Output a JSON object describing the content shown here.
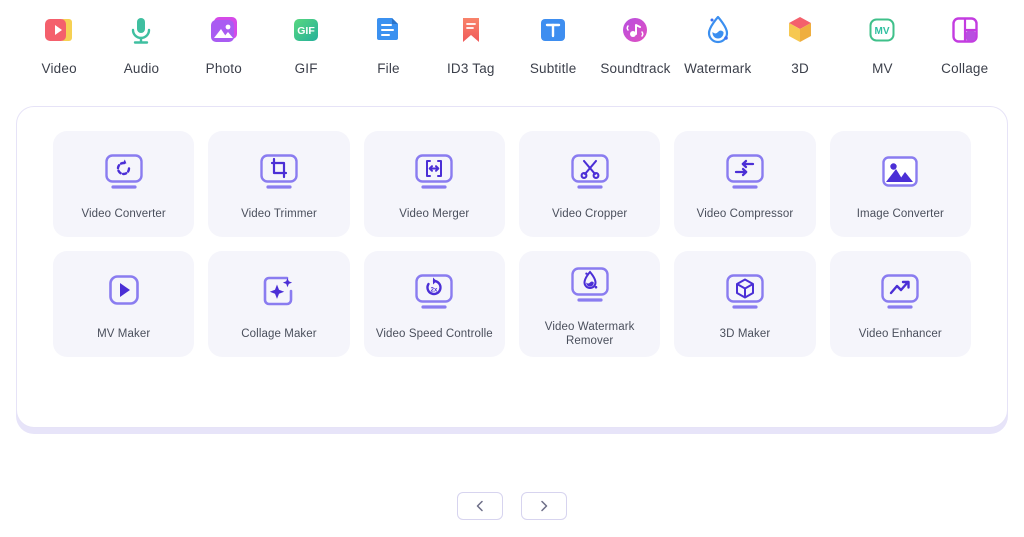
{
  "topnav": {
    "items": [
      {
        "label": "Video",
        "icon": "video-icon"
      },
      {
        "label": "Audio",
        "icon": "microphone-icon"
      },
      {
        "label": "Photo",
        "icon": "photo-icon"
      },
      {
        "label": "GIF",
        "icon": "gif-icon"
      },
      {
        "label": "File",
        "icon": "file-icon"
      },
      {
        "label": "ID3 Tag",
        "icon": "bookmark-icon"
      },
      {
        "label": "Subtitle",
        "icon": "subtitle-t-icon"
      },
      {
        "label": "Soundtrack",
        "icon": "soundtrack-disc-icon"
      },
      {
        "label": "Watermark",
        "icon": "watermark-drop-icon"
      },
      {
        "label": "3D",
        "icon": "cube-3d-icon"
      },
      {
        "label": "MV",
        "icon": "mv-icon"
      },
      {
        "label": "Collage",
        "icon": "collage-grid-icon"
      }
    ]
  },
  "tools": {
    "items": [
      {
        "label": "Video Converter",
        "icon": "monitor-rotate-icon"
      },
      {
        "label": "Video Trimmer",
        "icon": "monitor-crop-icon"
      },
      {
        "label": "Video Merger",
        "icon": "monitor-merge-icon"
      },
      {
        "label": "Video Cropper",
        "icon": "monitor-scissors-icon"
      },
      {
        "label": "Video Compressor",
        "icon": "monitor-compress-arrows-icon"
      },
      {
        "label": "Image Converter",
        "icon": "picture-frame-icon"
      },
      {
        "label": "MV Maker",
        "icon": "square-play-icon"
      },
      {
        "label": "Collage Maker",
        "icon": "frame-sparkle-icon"
      },
      {
        "label": "Video Speed Controlle",
        "icon": "monitor-speed-icon"
      },
      {
        "label": "Video Watermark Remover",
        "icon": "monitor-droplet-icon"
      },
      {
        "label": "3D Maker",
        "icon": "monitor-cube-icon"
      },
      {
        "label": "Video Enhancer",
        "icon": "monitor-trend-icon"
      }
    ]
  },
  "pagination": {
    "prev_label": "‹",
    "next_label": "›"
  },
  "colors": {
    "accent": "#7b6cf0",
    "glyph": "#4b2fd6",
    "tile_bg": "#f5f5fb",
    "panel_border": "#e6e3f7",
    "panel_shadow": "#e7e4f9",
    "text": "#3b3f4a"
  }
}
